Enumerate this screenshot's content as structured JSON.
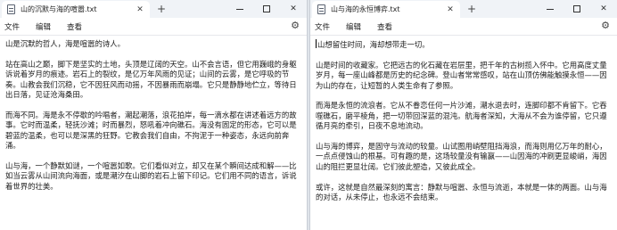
{
  "windows": [
    {
      "tab_title": "山的沉默与海的喧嚣.txt",
      "menu": [
        "文件",
        "编辑",
        "查看"
      ],
      "paragraphs": [
        "山是沉默的哲人，海是喧嚣的诗人。",
        "站在高山之巅，脚下是坚实的土地，头顶是辽阔的天空。山不会言语，但它用巍峨的身躯诉说着岁月的痕迹。岩石上的裂纹，是亿万年风雨的见证；山间的云雾，是它呼吸的节奏。山教会我们沉稳，它不因狂风而动摇，不因暴雨而崩塌。它只是静静地伫立，等待日出日落，见证沧海桑田。",
        "而海不同。海是永不停歇的吟唱者，潮起潮落，浪花拍岸，每一滴水都在讲述着远方的故事。它时而温柔，轻抚沙滩；时而暴烈，怒吼着冲向礁石。海没有固定的形态，它可以是碧蓝的温柔，也可以是深黑的狂野。它教会我们自由，不拘泥于一种姿态，永远向前奔涌。",
        "山与海，一个静默如谜，一个喧嚣如歌。它们看似对立，却又在某个瞬间达成和解——比如当云雾从山间流向海面，或是潮汐在山脚的岩石上留下印记。它们用不同的语言，诉说着世界的壮美。"
      ]
    },
    {
      "tab_title": "山与海的永恒博弈.txt",
      "menu": [
        "文件",
        "编辑",
        "查看"
      ],
      "paragraphs": [
        "山想留住时间，海却想带走一切。",
        "山是时间的收藏家。它把远古的化石藏在岩层里，把千年的古树揽入怀中。它用高度丈量岁月，每一座山峰都是历史的纪念碑。登山者常常感叹，站在山顶仿佛能触摸永恒——因为山的存在，让短暂的人类生命有了参照。",
        "而海是永恒的流浪者。它从不眷恋任何一片沙滩，潮水退去时，连脚印都不肯留下。它吞噬礁石，磨平棱角，把一切带回深蓝的混沌。航海者深知，大海从不会为谁停留，它只遵循月亮的牵引，日夜不息地流动。",
        "山与海的博弈，是固守与流动的较量。山试图用峭壁阻挡海浪，而海则用亿万年的耐心，一点点侵蚀山的根基。可有趣的是，这场较量没有输赢——山因海的冲刷更显峻峭，海因山的阻拦更显壮阔。它们彼此塑造，又彼此成全。",
        "或许，这就是自然最深刻的寓言：静默与喧嚣、永恒与流逝，本就是一体的两面。山与海的对话，从未停止，也永远不会结束。"
      ]
    }
  ]
}
